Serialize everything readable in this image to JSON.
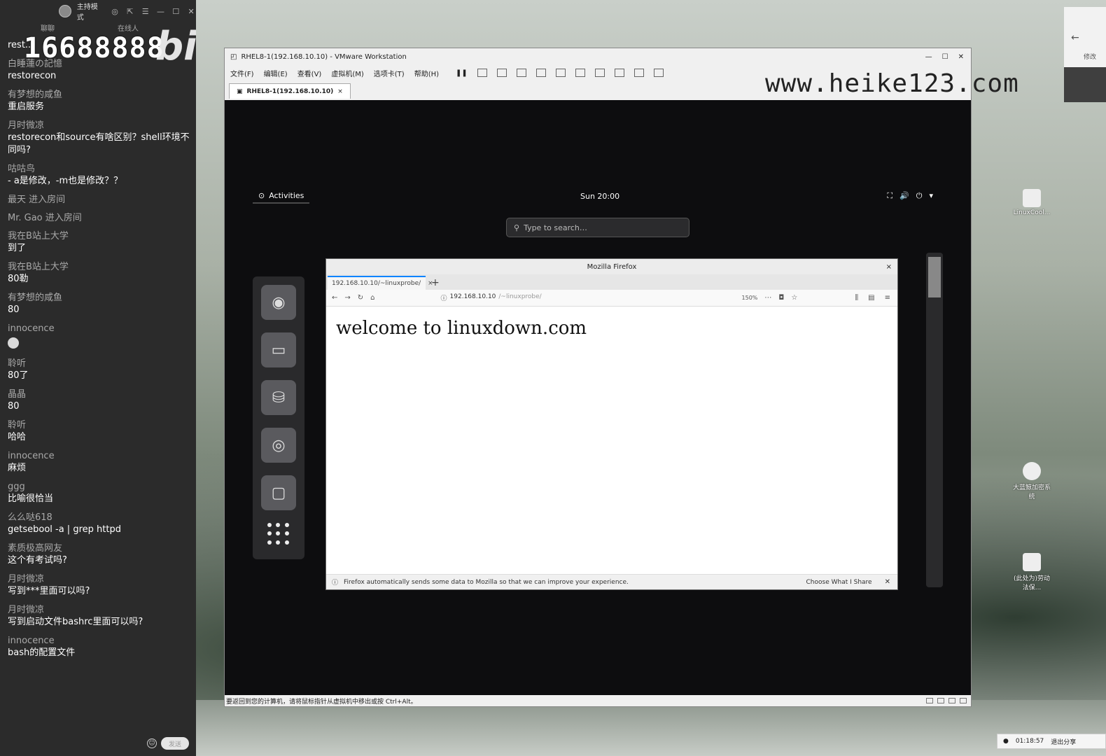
{
  "chat": {
    "header_title": "主持模式",
    "tabs": [
      "聊聊",
      "在线人"
    ],
    "watermark_number": "16688888",
    "watermark_logo": "bilibili",
    "messages": [
      {
        "user": "",
        "text": "rest..."
      },
      {
        "user": "白睡蓮の記憶",
        "text": "restorecon"
      },
      {
        "user": "有梦想的咸鱼",
        "text": "重启服务"
      },
      {
        "user": "月时微凉",
        "text": "restorecon和source有啥区别？shell环境不同吗?"
      },
      {
        "user": "咕咕鸟",
        "text": " - a是修改，-m也是修改？？"
      },
      {
        "user": "最天 进入房间",
        "text": ""
      },
      {
        "user": "Mr. Gao 进入房间",
        "text": ""
      },
      {
        "user": "我在B站上大学",
        "text": "到了"
      },
      {
        "user": "我在B站上大学",
        "text": "80勒"
      },
      {
        "user": "有梦想的咸鱼",
        "text": "80"
      },
      {
        "user": "innocence",
        "text": "",
        "emoji": true
      },
      {
        "user": "聆听",
        "text": "80了"
      },
      {
        "user": "晶晶",
        "text": "80"
      },
      {
        "user": "聆听",
        "text": "哈哈"
      },
      {
        "user": "innocence",
        "text": "麻烦"
      },
      {
        "user": "ggg",
        "text": "比喻很恰当"
      },
      {
        "user": "么么哒618",
        "text": "getsebool -a | grep httpd"
      },
      {
        "user": "素质极高网友",
        "text": "这个有考试吗?"
      },
      {
        "user": "月时微凉",
        "text": "写到***里面可以吗?"
      },
      {
        "user": "月时微凉",
        "text": "写到启动文件bashrc里面可以吗?"
      },
      {
        "user": "innocence",
        "text": "bash的配置文件"
      }
    ],
    "send_label": "发送"
  },
  "vmware": {
    "title": "RHEL8-1(192.168.10.10) - VMware Workstation",
    "menu": [
      "文件(F)",
      "编辑(E)",
      "查看(V)",
      "虚拟机(M)",
      "选项卡(T)",
      "帮助(H)"
    ],
    "tab_label": "RHEL8-1(192.168.10.10)",
    "site_watermark": "www.heike123.com",
    "status_text": "要返回到您的计算机，请将鼠标指针从虚拟机中移出或按 Ctrl+Alt。"
  },
  "gnome": {
    "activities": "Activities",
    "clock": "Sun 20:00",
    "search_placeholder": "Type to search…"
  },
  "firefox": {
    "window_title": "Mozilla Firefox",
    "tab_title": "192.168.10.10/~linuxprobe/",
    "url_host": "192.168.10.10",
    "url_path": "/~linuxprobe/",
    "zoom": "150%",
    "page_heading": "welcome to linuxdown.com",
    "notice_text": "Firefox automatically sends some data to Mozilla so that we can improve your experience.",
    "notice_button": "Choose What I Share"
  },
  "desktop": {
    "right_label": "修改",
    "icons": [
      {
        "label": "LinuxCool..."
      },
      {
        "label": "大蓝鲸加密系统"
      },
      {
        "label": "(此处为)劳动法保..."
      }
    ],
    "taskbar_time": "01:18:57",
    "taskbar_exit": "退出分享"
  }
}
